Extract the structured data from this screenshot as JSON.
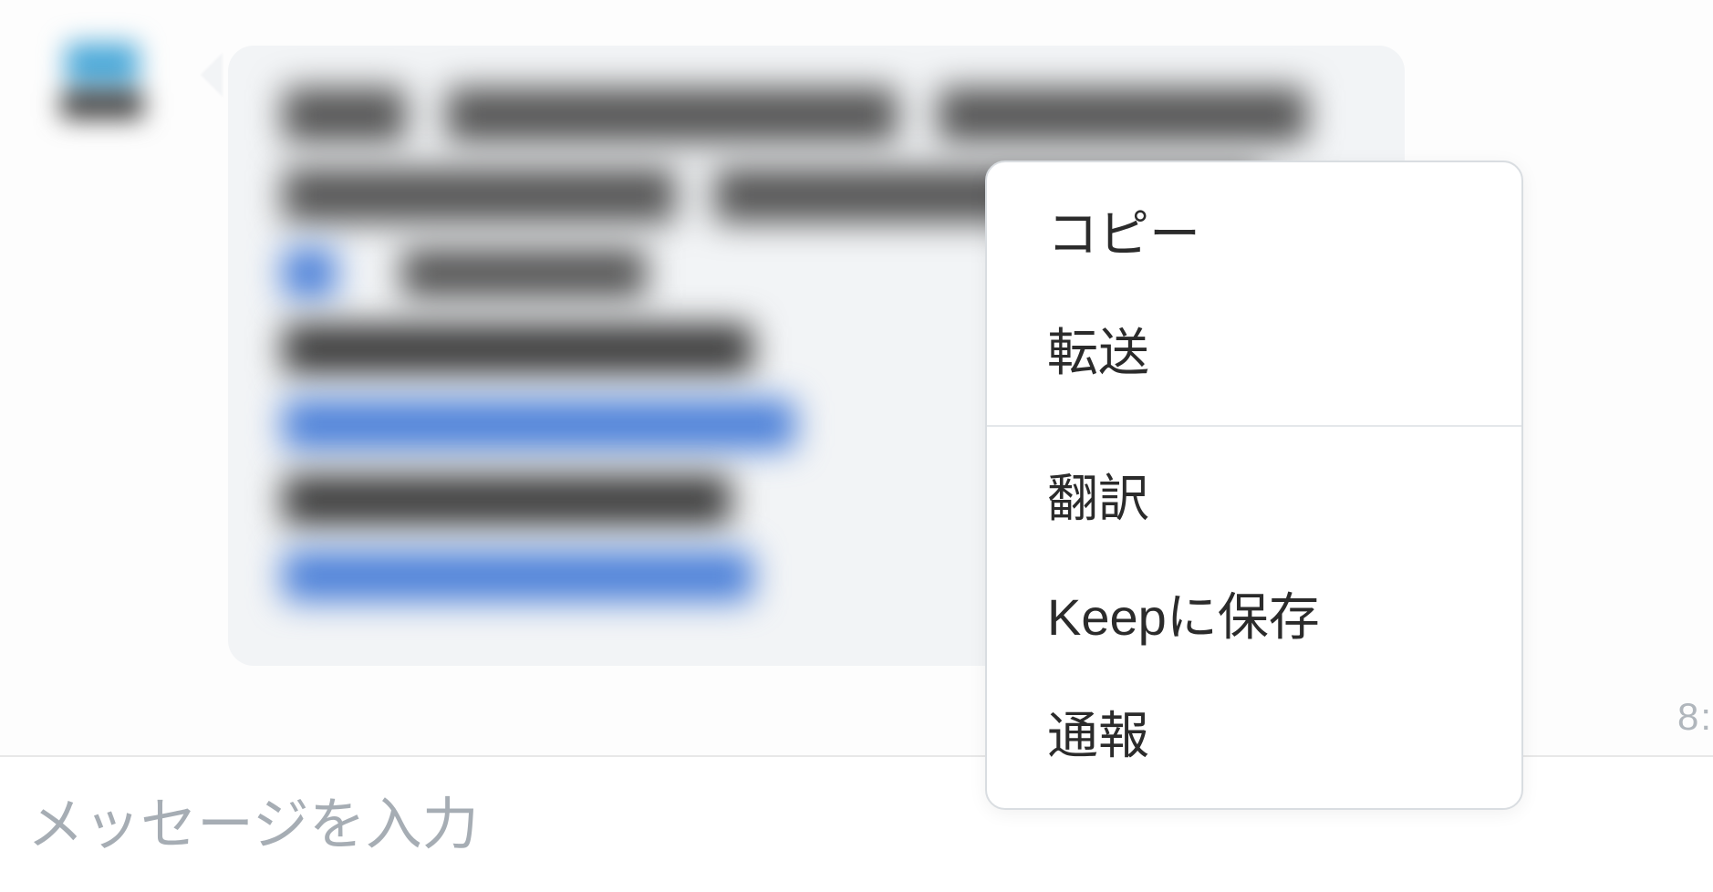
{
  "message": {
    "timestamp_partial": "8:"
  },
  "context_menu": {
    "group1": {
      "copy": "コピー",
      "forward": "転送"
    },
    "group2": {
      "translate": "翻訳",
      "keep": "Keepに保存",
      "report": "通報"
    }
  },
  "input": {
    "placeholder": "メッセージを入力"
  }
}
